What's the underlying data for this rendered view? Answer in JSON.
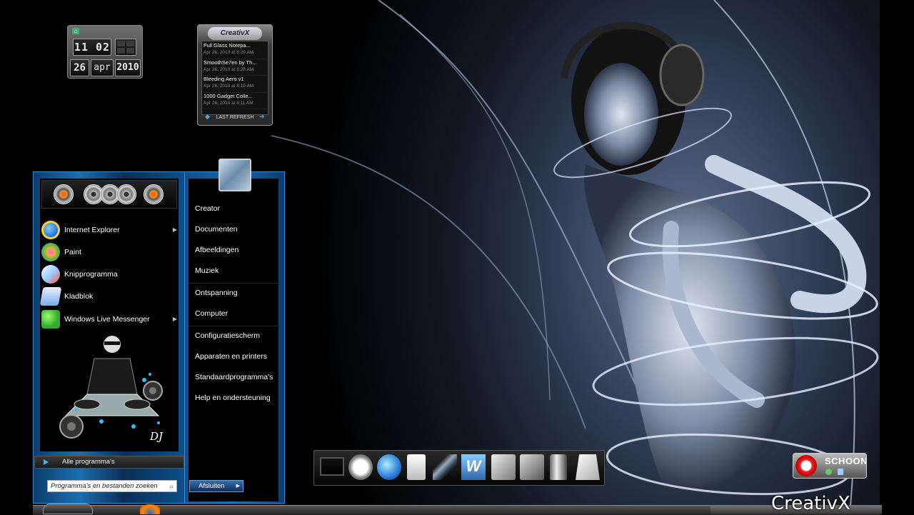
{
  "clock": {
    "time": "11 02",
    "day": "26",
    "month": "apr",
    "year": "2010"
  },
  "feed": {
    "logo": "CreativX",
    "items": [
      {
        "title": "Full Glass Notepa...",
        "date": "Apr 26, 2010 at 8:29 AM"
      },
      {
        "title": "SmoothSe7en by Th...",
        "date": "Apr 26, 2010 at 8:28 AM"
      },
      {
        "title": "Bleeding Aero v1",
        "date": "Apr 26, 2010 at 8:19 AM"
      },
      {
        "title": "1000 Gadget Colle...",
        "date": "Apr 26, 2010 at 8:11 AM"
      }
    ],
    "footer": "LAST REFRESH"
  },
  "startmenu": {
    "programs": [
      {
        "label": "Internet Explorer",
        "icon": "internet-explorer-icon",
        "submenu": true
      },
      {
        "label": "Paint",
        "icon": "paint-icon",
        "submenu": false
      },
      {
        "label": "Knipprogramma",
        "icon": "snipping-tool-icon",
        "submenu": false
      },
      {
        "label": "Kladblok",
        "icon": "notepad-icon",
        "submenu": false
      },
      {
        "label": "Windows Live Messenger",
        "icon": "messenger-icon",
        "submenu": true
      }
    ],
    "art_label": "DJ",
    "all_programs": "Alle programma's",
    "search_placeholder": "Programma's en bestanden zoeken",
    "shutdown": "Afsluiten",
    "right_links": [
      "Creator",
      "Documenten",
      "Afbeeldingen",
      "Muziek",
      "Ontspanning",
      "Computer",
      "Configuratiescherm",
      "Apparaten en printers",
      "Standaardprogramma's",
      "Help en ondersteuning"
    ]
  },
  "dock": {
    "items": [
      "monitor-icon",
      "smiley-icon",
      "internet-explorer-icon",
      "document-icon",
      "feather-icon",
      "word-icon",
      "window-box-icon",
      "window-box-icon",
      "trash-icon",
      "recycle-icon"
    ]
  },
  "school": {
    "label": "SCHOON"
  },
  "watermark": "CreativX",
  "colors": {
    "accent": "#1b6fb0",
    "background": "#000000"
  }
}
